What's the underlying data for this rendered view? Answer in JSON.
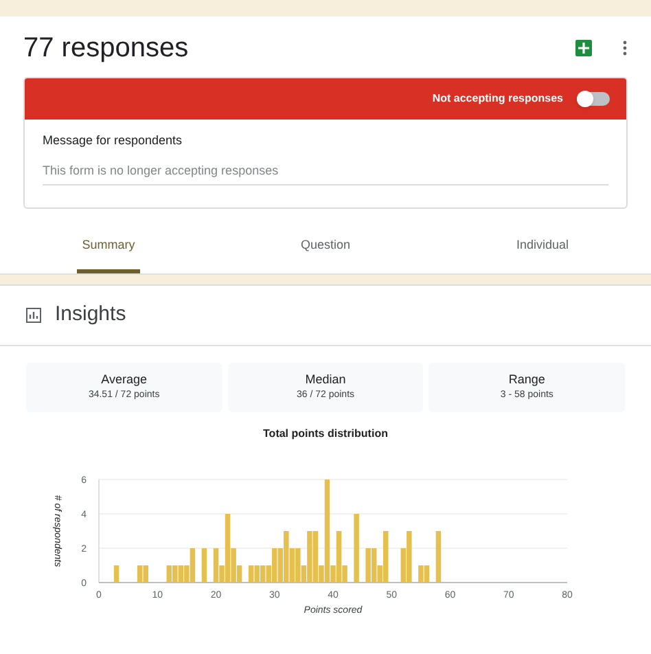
{
  "header": {
    "title": "77 responses"
  },
  "status_banner": {
    "label": "Not accepting responses",
    "on": false
  },
  "message": {
    "label": "Message for respondents",
    "placeholder": "This form is no longer accepting responses"
  },
  "tabs": [
    {
      "label": "Summary",
      "selected": true
    },
    {
      "label": "Question",
      "selected": false
    },
    {
      "label": "Individual",
      "selected": false
    }
  ],
  "insights": {
    "title": "Insights"
  },
  "stats": [
    {
      "label": "Average",
      "value": "34.51 / 72 points"
    },
    {
      "label": "Median",
      "value": "36 / 72 points"
    },
    {
      "label": "Range",
      "value": "3 - 58 points"
    }
  ],
  "chart": {
    "chart_data": {
      "type": "bar",
      "title": "Total points distribution",
      "xlabel": "Points scored",
      "ylabel": "# of respondents",
      "x": [
        3,
        7,
        8,
        12,
        13,
        14,
        15,
        16,
        18,
        20,
        21,
        22,
        23,
        24,
        26,
        27,
        28,
        29,
        30,
        31,
        32,
        33,
        34,
        35,
        36,
        37,
        38,
        39,
        40,
        41,
        42,
        44,
        46,
        47,
        48,
        49,
        52,
        53,
        55,
        56,
        58
      ],
      "series": [
        {
          "color": "#e6c04f",
          "values": [
            1,
            1,
            1,
            1,
            1,
            1,
            1,
            2,
            2,
            2,
            1,
            4,
            2,
            1,
            1,
            1,
            1,
            1,
            2,
            2,
            3,
            2,
            2,
            1,
            3,
            3,
            1,
            6,
            1,
            3,
            1,
            4,
            2,
            2,
            1,
            3,
            2,
            3,
            1,
            1,
            3
          ]
        }
      ],
      "xlim": [
        0,
        80
      ],
      "ylim": [
        0,
        6
      ],
      "xticks": [
        0,
        10,
        20,
        30,
        40,
        50,
        60,
        70,
        80
      ],
      "yticks": [
        0,
        2,
        4,
        6
      ]
    }
  }
}
